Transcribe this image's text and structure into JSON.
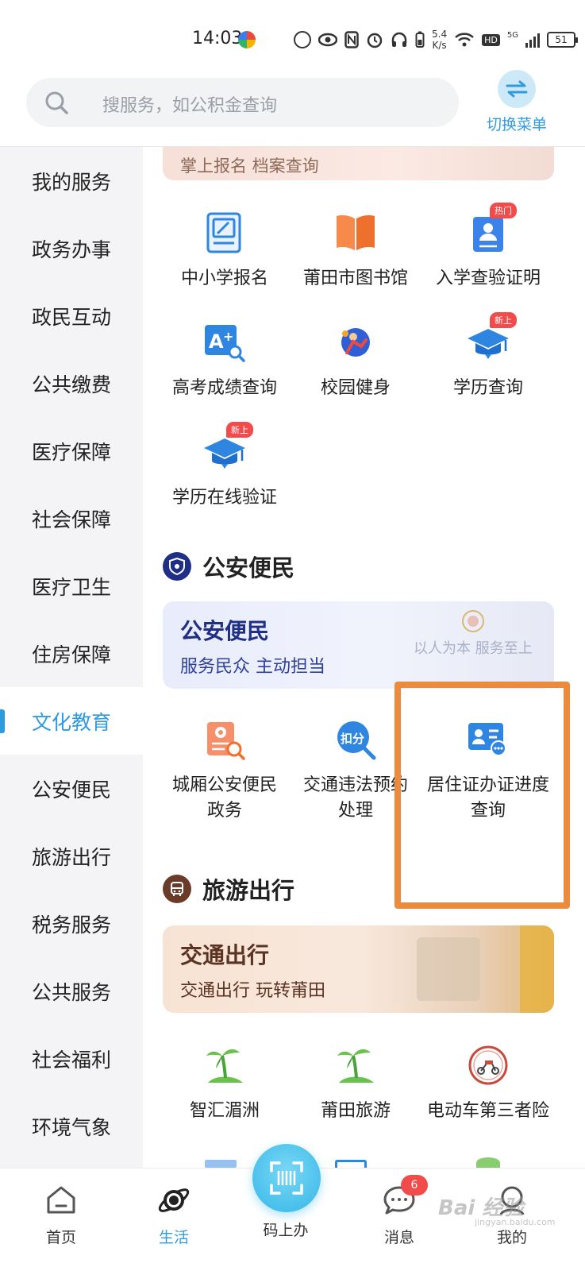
{
  "status_bar": {
    "time": "14:03",
    "net_speed_value": "5.4",
    "net_speed_unit": "K/s",
    "hd_label": "HD",
    "network_type": "5G",
    "battery_level": "51"
  },
  "header": {
    "search_placeholder": "搜服务，如公积金查询",
    "switch_menu_label": "切换菜单"
  },
  "sidebar": {
    "active_index": 8,
    "items": [
      {
        "label": "我的服务"
      },
      {
        "label": "政务办事"
      },
      {
        "label": "政民互动"
      },
      {
        "label": "公共缴费"
      },
      {
        "label": "医疗保障"
      },
      {
        "label": "社会保障"
      },
      {
        "label": "医疗卫生"
      },
      {
        "label": "住房保障"
      },
      {
        "label": "文化教育"
      },
      {
        "label": "公安便民"
      },
      {
        "label": "旅游出行"
      },
      {
        "label": "税务服务"
      },
      {
        "label": "公共服务"
      },
      {
        "label": "社会福利"
      },
      {
        "label": "环境气象"
      }
    ]
  },
  "content": {
    "top_banner_text": "掌上报名 档案查询",
    "education_services": [
      {
        "label": "中小学报名",
        "icon": "form-edit-icon"
      },
      {
        "label": "莆田市图书馆",
        "icon": "open-book-icon"
      },
      {
        "label": "入学查验证明",
        "icon": "certificate-icon",
        "badge": "热门"
      },
      {
        "label": "高考成绩查询",
        "icon": "score-search-icon"
      },
      {
        "label": "校园健身",
        "icon": "fitness-icon"
      },
      {
        "label": "学历查询",
        "icon": "graduation-cap-icon",
        "badge": "新上"
      },
      {
        "label": "学历在线验证",
        "icon": "graduation-cap-icon",
        "badge": "新上"
      }
    ],
    "police_section": {
      "title": "公安便民",
      "banner_title": "公安便民",
      "banner_subtitle": "服务民众 主动担当",
      "banner_motto": "以人为本  服务至上",
      "services": [
        {
          "label": "城厢公安便民政务",
          "icon": "police-doc-icon"
        },
        {
          "label": "交通违法预约处理",
          "icon": "deduct-points-icon",
          "icon_text": "扣分"
        },
        {
          "label": "居住证办证进度查询",
          "icon": "id-card-search-icon"
        }
      ]
    },
    "travel_section": {
      "title": "旅游出行",
      "banner_title": "交通出行",
      "banner_subtitle": "交通出行 玩转莆田",
      "services": [
        {
          "label": "智汇湄洲",
          "icon": "palm-island-icon"
        },
        {
          "label": "莆田旅游",
          "icon": "palm-island-icon"
        },
        {
          "label": "电动车第三者险",
          "icon": "e-scooter-icon"
        }
      ]
    }
  },
  "bottom_nav": {
    "items": [
      {
        "label": "首页",
        "icon": "home-icon"
      },
      {
        "label": "生活",
        "icon": "planet-icon"
      },
      {
        "label": "码上办",
        "icon": "scan-code-icon"
      },
      {
        "label": "消息",
        "icon": "chat-icon",
        "badge": "6"
      },
      {
        "label": "我的",
        "icon": "profile-icon"
      }
    ],
    "active_index": 1
  },
  "watermark": {
    "text": "Bai 经验",
    "sub": "jingyan.baidu.com"
  },
  "colors": {
    "accent": "#2f9ae0",
    "highlight_box": "#ee8a3c",
    "badge_red": "#f24b4b",
    "police_dark": "#1f2f86",
    "travel_brown": "#6b3b2a"
  }
}
